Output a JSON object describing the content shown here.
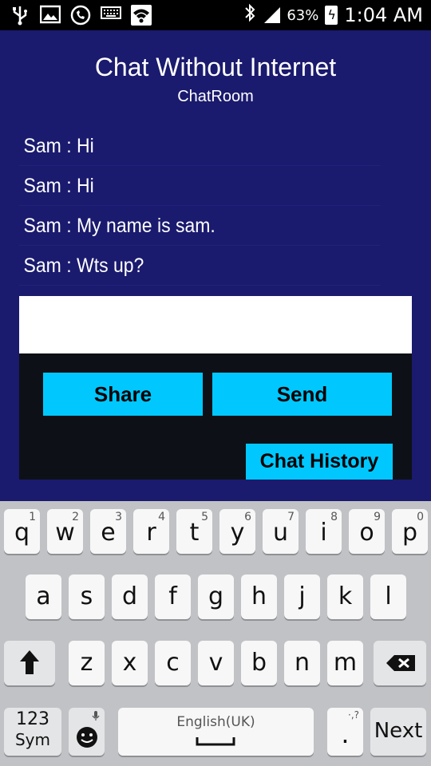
{
  "status_bar": {
    "icons_left": [
      "usb-icon",
      "image-icon",
      "call-icon",
      "keyboard-icon",
      "wifi-icon"
    ],
    "battery_percent": "63%",
    "time": "1:04 AM"
  },
  "app": {
    "title": "Chat Without Internet",
    "subtitle": "ChatRoom",
    "messages": [
      "Sam : Hi",
      "Sam : Hi",
      "Sam : My name is sam.",
      "Sam : Wts up?"
    ],
    "input": {
      "value": "",
      "placeholder": ""
    },
    "buttons": {
      "share": "Share",
      "send": "Send",
      "history": "Chat History"
    },
    "colors": {
      "background": "#1a1a6e",
      "button": "#00c8ff",
      "panel": "#0d1117"
    }
  },
  "keyboard": {
    "row1": [
      {
        "k": "q",
        "n": "1"
      },
      {
        "k": "w",
        "n": "2"
      },
      {
        "k": "e",
        "n": "3"
      },
      {
        "k": "r",
        "n": "4"
      },
      {
        "k": "t",
        "n": "5"
      },
      {
        "k": "y",
        "n": "6"
      },
      {
        "k": "u",
        "n": "7"
      },
      {
        "k": "i",
        "n": "8"
      },
      {
        "k": "o",
        "n": "9"
      },
      {
        "k": "p",
        "n": "0"
      }
    ],
    "row2": [
      "a",
      "s",
      "d",
      "f",
      "g",
      "h",
      "j",
      "k",
      "l"
    ],
    "row3": [
      "z",
      "x",
      "c",
      "v",
      "b",
      "n",
      "m"
    ],
    "sym_top": "123",
    "sym_bottom": "Sym",
    "space_label": "English(UK)",
    "period": ".",
    "period_sub": "·,?",
    "next": "Next"
  }
}
